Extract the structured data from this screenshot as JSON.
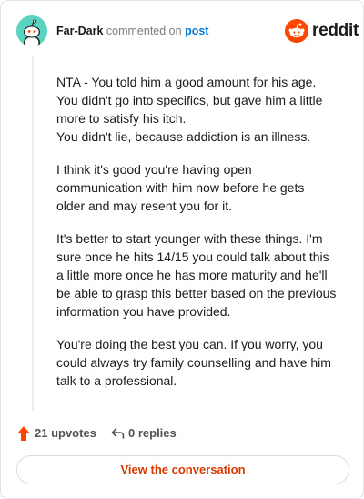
{
  "header": {
    "author": "Far-Dark",
    "action_text": "commented on",
    "post_link": "post",
    "brand_name": "reddit"
  },
  "comment": {
    "paragraphs": [
      "NTA - You told him a good amount for his age.\nYou didn't go into specifics, but gave him a little\nmore to satisfy his itch.\nYou didn't lie, because addiction is an illness.",
      "I think it's good you're having open\ncommunication with him now before he gets\nolder and may resent you for it.",
      "It's better to start younger with these things. I'm\nsure once he hits 14/15 you could talk about this\na little more once he has more maturity and he'll\nbe able to grasp this better based on the previous\ninformation you have provided.",
      "You're doing the best you can. If you worry, you\ncould always try family counselling and have him\ntalk to a professional."
    ]
  },
  "footer": {
    "upvotes": "21 upvotes",
    "replies": "0 replies",
    "view_button": "View the conversation"
  },
  "colors": {
    "avatar_bg": "#5ad4bf",
    "reddit_orange": "#ff4500",
    "link_blue": "#0079d3",
    "cta_text": "#d93a00"
  },
  "icons": {
    "avatar": "snoo-avatar-icon",
    "brand": "reddit-logo-icon",
    "upvote": "upvote-arrow-icon",
    "reply": "reply-arrow-icon"
  }
}
